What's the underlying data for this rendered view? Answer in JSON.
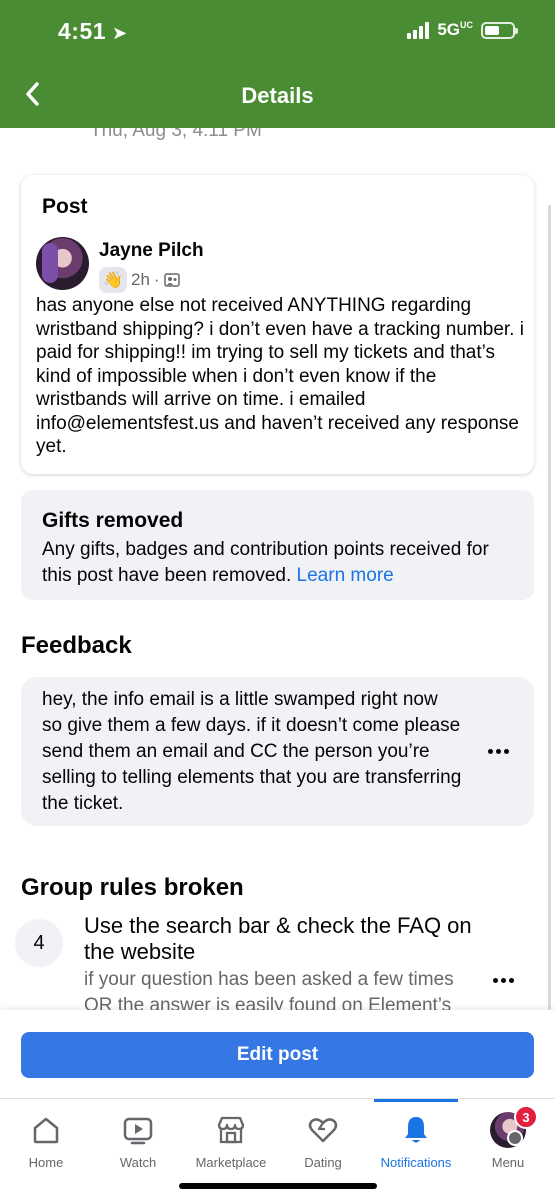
{
  "status_bar": {
    "time": "4:51",
    "network": "5G",
    "network_suffix": "UC"
  },
  "nav": {
    "title": "Details"
  },
  "post_date": "Thu, Aug 3, 4:11 PM",
  "post": {
    "heading": "Post",
    "author": "Jayne Pilch",
    "time": "2h",
    "separator": "·",
    "body": "has anyone else not received ANYTHING regarding wristband shipping? i don’t even have a tracking number. i paid for shipping!! im trying to sell my tickets and that’s kind of impossible when i don’t even know if the wristbands will arrive on time. i emailed info@elementsfest.us and haven’t received any response yet."
  },
  "gifts": {
    "title": "Gifts removed",
    "body": "Any gifts, badges and contribution points received for this post have been removed.",
    "link": "Learn more"
  },
  "feedback": {
    "title": "Feedback",
    "text": "hey, the info email is a little swamped right now so give them a few days. if it doesn’t come please send them an email and CC the person you’re selling to telling elements that you are transferring the ticket."
  },
  "rules": {
    "title": "Group rules broken",
    "number": "4",
    "rule_title": "Use the search bar & check the FAQ on the website",
    "rule_desc": "if your question has been asked a few times OR the answer is easily found on Element’s"
  },
  "edit_button": "Edit post",
  "tabs": [
    {
      "label": "Home",
      "icon": "home-icon"
    },
    {
      "label": "Watch",
      "icon": "watch-icon"
    },
    {
      "label": "Marketplace",
      "icon": "marketplace-icon"
    },
    {
      "label": "Dating",
      "icon": "dating-icon"
    },
    {
      "label": "Notifications",
      "icon": "bell-icon"
    },
    {
      "label": "Menu",
      "icon": "avatar"
    }
  ],
  "menu_badge": "3",
  "colors": {
    "header": "#4a8c34",
    "accent": "#1b74e4",
    "button": "#3578e5",
    "badge": "#e41e3f"
  }
}
